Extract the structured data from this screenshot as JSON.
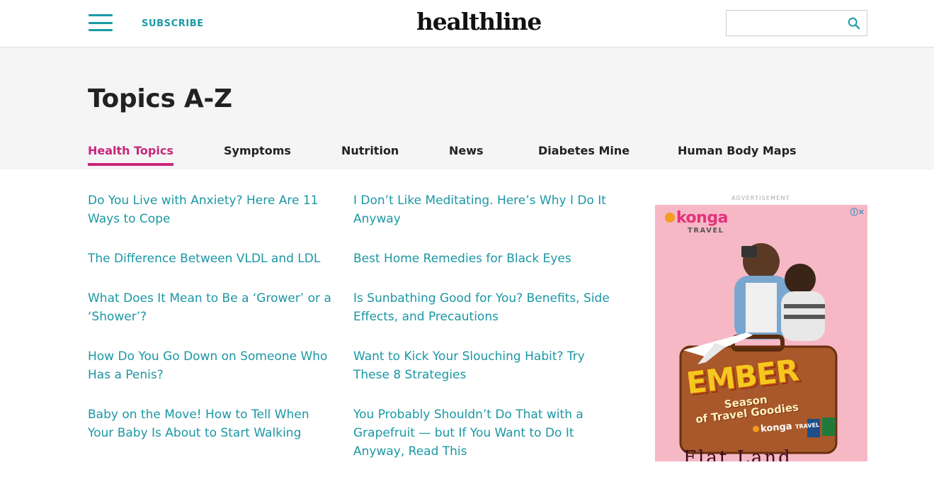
{
  "header": {
    "subscribe_label": "SUBSCRIBE",
    "logo_text": "healthline",
    "search_placeholder": ""
  },
  "page": {
    "title": "Topics A-Z"
  },
  "tabs": [
    {
      "label": "Health Topics",
      "active": true
    },
    {
      "label": "Symptoms",
      "active": false
    },
    {
      "label": "Nutrition",
      "active": false
    },
    {
      "label": "News",
      "active": false
    },
    {
      "label": "Diabetes Mine",
      "active": false
    },
    {
      "label": "Human Body Maps",
      "active": false
    }
  ],
  "articles": {
    "left": [
      "Do You Live with Anxiety? Here Are 11 Ways to Cope",
      "The Difference Between VLDL and LDL",
      "What Does It Mean to Be a ‘Grower’ or a ‘Shower’?",
      "How Do You Go Down on Someone Who Has a Penis?",
      "Baby on the Move! How to Tell When Your Baby Is About to Start Walking"
    ],
    "right": [
      "I Don’t Like Meditating. Here’s Why I Do It Anyway",
      "Best Home Remedies for Black Eyes",
      "Is Sunbathing Good for You? Benefits, Side Effects, and Precautions",
      "Want to Kick Your Slouching Habit? Try These 8 Strategies",
      "You Probably Shouldn’t Do That with a Grapefruit — but If You Want to Do It Anyway, Read This"
    ]
  },
  "ad": {
    "label": "ADVERTISEMENT",
    "brand": "konga",
    "brand_sub": "TRAVEL",
    "headline": "EMBER",
    "subline_1": "Season",
    "subline_2": "of Travel Goodies",
    "small_brand": "konga",
    "small_sub": "TRAVEL",
    "bottom_text": "Flat Land"
  },
  "colors": {
    "brand_teal": "#1a9aa6",
    "active_tab": "#c8267b",
    "link": "#1b97a4",
    "hero_bg": "#f5f5f5"
  }
}
